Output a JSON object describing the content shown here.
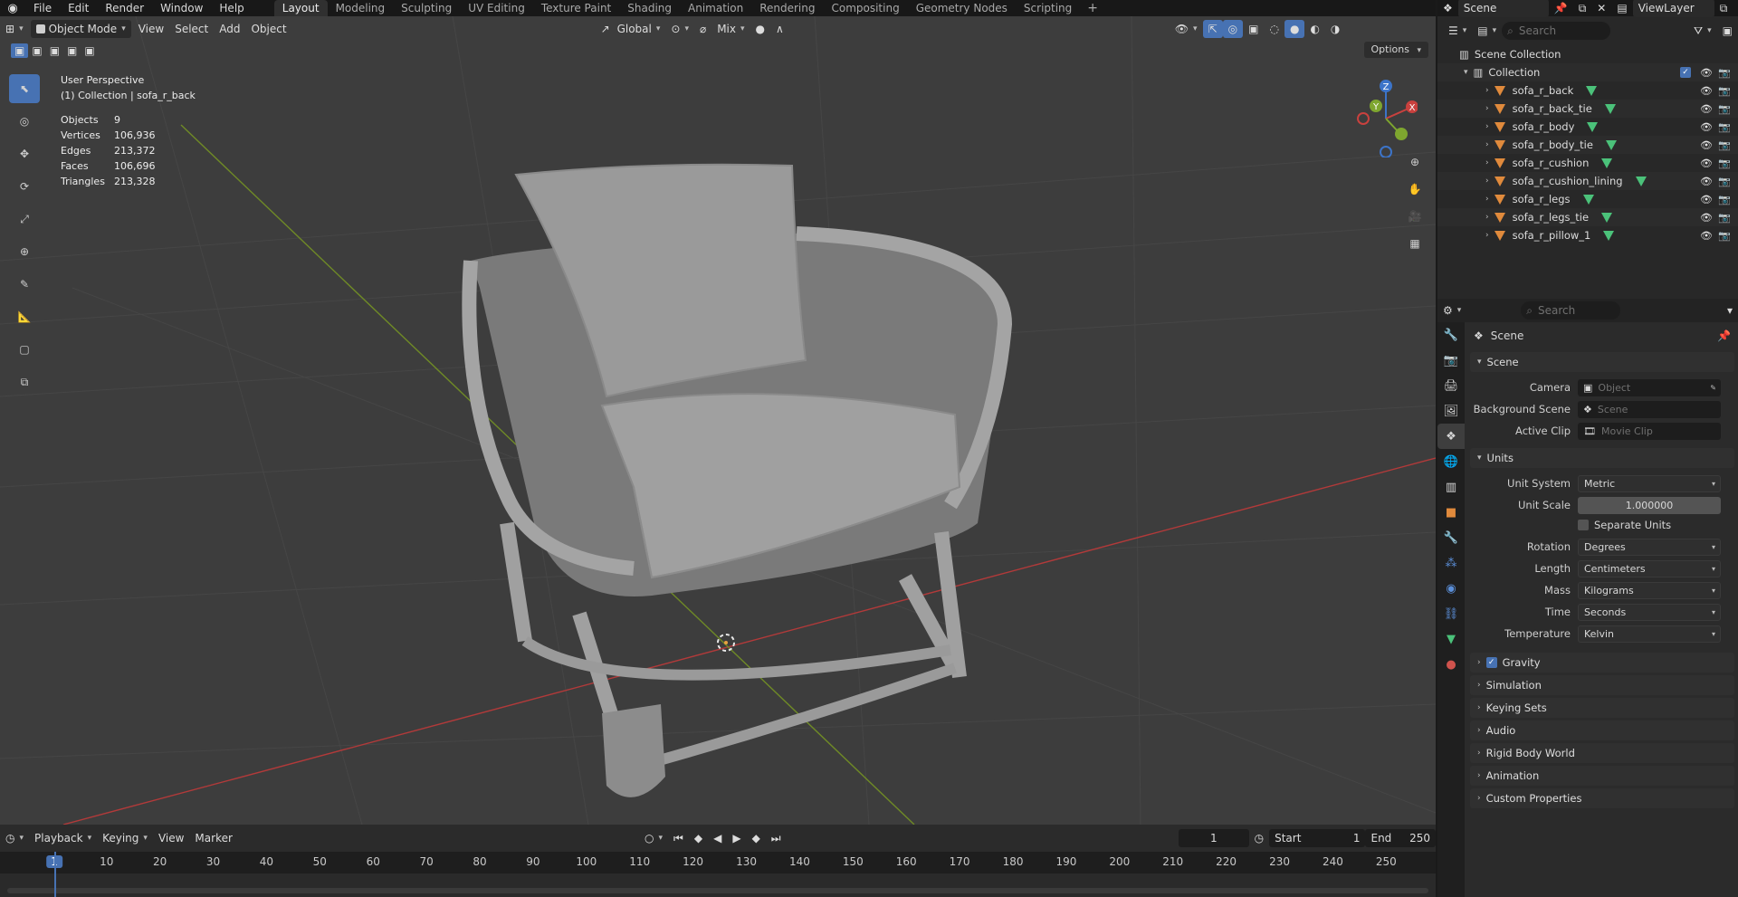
{
  "menu": [
    "File",
    "Edit",
    "Render",
    "Window",
    "Help"
  ],
  "workspaces": [
    {
      "label": "Layout",
      "active": true
    },
    {
      "label": "Modeling"
    },
    {
      "label": "Sculpting"
    },
    {
      "label": "UV Editing"
    },
    {
      "label": "Texture Paint"
    },
    {
      "label": "Shading"
    },
    {
      "label": "Animation"
    },
    {
      "label": "Rendering"
    },
    {
      "label": "Compositing"
    },
    {
      "label": "Geometry Nodes"
    },
    {
      "label": "Scripting"
    }
  ],
  "scene_selector": "Scene",
  "viewlayer_selector": "ViewLayer",
  "viewport": {
    "mode": "Object Mode",
    "menus": [
      "View",
      "Select",
      "Add",
      "Object"
    ],
    "transform_orientation": "Global",
    "snapping": "Mix",
    "options_label": "Options",
    "perspective": "User Perspective",
    "collection_info": "(1) Collection | sofa_r_back",
    "stats": [
      {
        "label": "Objects",
        "value": "9"
      },
      {
        "label": "Vertices",
        "value": "106,936"
      },
      {
        "label": "Edges",
        "value": "213,372"
      },
      {
        "label": "Faces",
        "value": "106,696"
      },
      {
        "label": "Triangles",
        "value": "213,328"
      }
    ],
    "gizmo": {
      "x": "X",
      "y": "Y",
      "z": "Z"
    }
  },
  "timeline": {
    "menus": [
      "Playback",
      "Keying",
      "View",
      "Marker"
    ],
    "current_frame": "1",
    "start_label": "Start",
    "start": "1",
    "end_label": "End",
    "end": "250",
    "ruler": [
      "1",
      "10",
      "20",
      "30",
      "40",
      "50",
      "60",
      "70",
      "80",
      "90",
      "100",
      "110",
      "120",
      "130",
      "140",
      "150",
      "160",
      "170",
      "180",
      "190",
      "200",
      "210",
      "220",
      "230",
      "240",
      "250"
    ]
  },
  "outliner": {
    "search_placeholder": "Search",
    "scene_collection": "Scene Collection",
    "collection": "Collection",
    "objects": [
      "sofa_r_back",
      "sofa_r_back_tie",
      "sofa_r_body",
      "sofa_r_body_tie",
      "sofa_r_cushion",
      "sofa_r_cushion_lining",
      "sofa_r_legs",
      "sofa_r_legs_tie",
      "sofa_r_pillow_1"
    ]
  },
  "properties": {
    "search_placeholder": "Search",
    "context": "Scene",
    "scene_panel": {
      "title": "Scene",
      "camera_label": "Camera",
      "camera_placeholder": "Object",
      "background_label": "Background Scene",
      "background_placeholder": "Scene",
      "clip_label": "Active Clip",
      "clip_placeholder": "Movie Clip"
    },
    "units_panel": {
      "title": "Units",
      "unit_system_label": "Unit System",
      "unit_system": "Metric",
      "unit_scale_label": "Unit Scale",
      "unit_scale": "1.000000",
      "separate_units": "Separate Units",
      "rotation_label": "Rotation",
      "rotation": "Degrees",
      "length_label": "Length",
      "length": "Centimeters",
      "mass_label": "Mass",
      "mass": "Kilograms",
      "time_label": "Time",
      "time": "Seconds",
      "temperature_label": "Temperature",
      "temperature": "Kelvin"
    },
    "collapsed_panels": [
      "Gravity",
      "Simulation",
      "Keying Sets",
      "Audio",
      "Rigid Body World",
      "Animation",
      "Custom Properties"
    ]
  },
  "colors": {
    "accent": "#4772b3",
    "object_orange": "#e08a3c",
    "mesh_green": "#4bc27a",
    "x_axis": "#c9413e",
    "y_axis": "#7ea62f",
    "z_axis": "#3c74c9"
  }
}
